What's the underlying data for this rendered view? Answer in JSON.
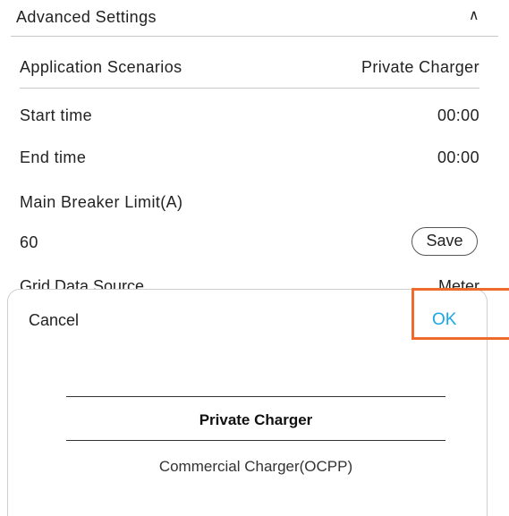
{
  "advanced": {
    "title": "Advanced Settings",
    "collapse_glyph": "∧",
    "application_scenarios_label": "Application Scenarios",
    "application_scenarios_value": "Private Charger",
    "start_time_label": "Start time",
    "start_time_value": "00:00",
    "end_time_label": "End time",
    "end_time_value": "00:00",
    "main_breaker_label": "Main Breaker Limit(A)",
    "main_breaker_value": "60",
    "save_label": "Save",
    "grid_source_label": "Grid Data Source",
    "grid_source_value": "Meter"
  },
  "picker": {
    "cancel_label": "Cancel",
    "ok_label": "OK",
    "options": [
      "Private Charger",
      "Commercial Charger(OCPP)"
    ],
    "selected_index": 0
  },
  "colors": {
    "accent": "#19a8e6",
    "highlight": "#ee6a2d"
  }
}
